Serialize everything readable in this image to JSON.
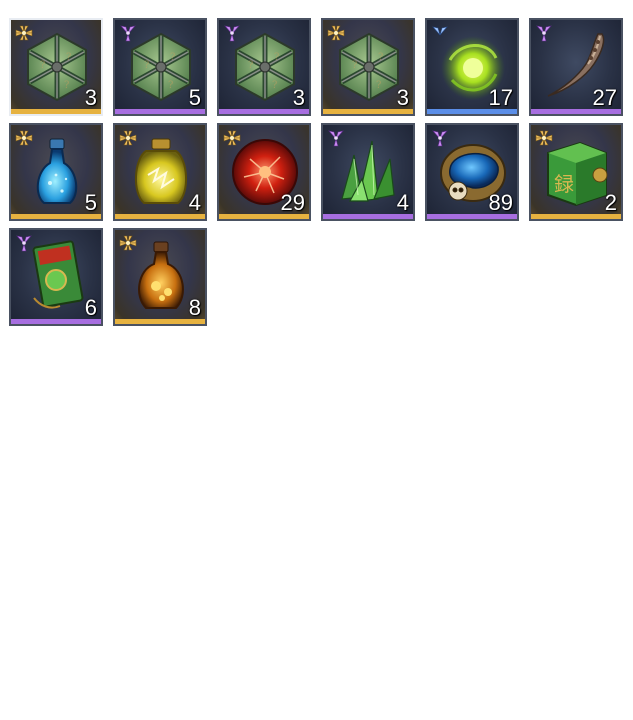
{
  "colors": {
    "gold": "#e6b240",
    "purple": "#a76ee0",
    "blue": "#5b8ee8",
    "slot_bg": "#2a3246",
    "slot_border": "#4a5262",
    "selected_border": "#e8ecf2"
  },
  "inventory": {
    "items": [
      {
        "qty": "3",
        "rarity": "gold",
        "icon": "green-armored-chest-icon",
        "selected": true
      },
      {
        "qty": "5",
        "rarity": "purple",
        "icon": "green-armored-chest-icon"
      },
      {
        "qty": "3",
        "rarity": "purple",
        "icon": "green-armored-chest-icon"
      },
      {
        "qty": "3",
        "rarity": "gold",
        "icon": "green-armored-chest-icon"
      },
      {
        "qty": "17",
        "rarity": "blue",
        "icon": "green-energy-orb-icon"
      },
      {
        "qty": "27",
        "rarity": "purple",
        "icon": "curved-claw-blade-icon"
      },
      {
        "qty": "5",
        "rarity": "gold",
        "icon": "blue-potion-bottle-icon"
      },
      {
        "qty": "4",
        "rarity": "gold",
        "icon": "yellow-potion-bottle-icon"
      },
      {
        "qty": "29",
        "rarity": "gold",
        "icon": "red-crystal-orb-icon"
      },
      {
        "qty": "4",
        "rarity": "purple",
        "icon": "green-crystal-shards-icon"
      },
      {
        "qty": "89",
        "rarity": "purple",
        "icon": "blue-gem-skull-ring-icon"
      },
      {
        "qty": "2",
        "rarity": "gold",
        "icon": "jade-cube-icon"
      },
      {
        "qty": "6",
        "rarity": "purple",
        "icon": "jade-talisman-tag-icon"
      },
      {
        "qty": "8",
        "rarity": "gold",
        "icon": "amber-potion-flask-icon"
      }
    ]
  }
}
